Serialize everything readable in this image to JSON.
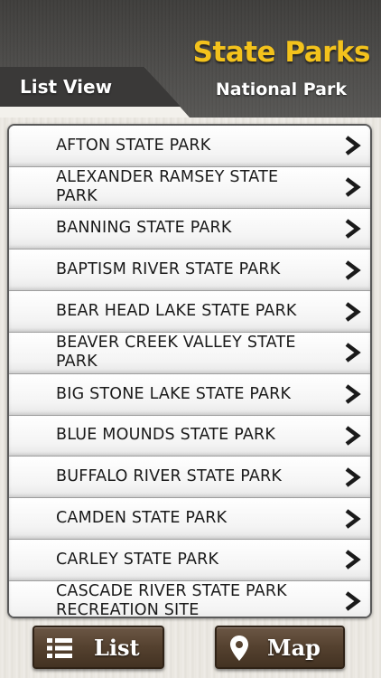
{
  "header": {
    "title": "State Parks",
    "subtitle": "National Park",
    "tab_label": "List View"
  },
  "colors": {
    "title": "#f3c21c",
    "header_bg": "#454442",
    "button_bg": "#5a4634"
  },
  "parks": [
    {
      "name": "AFTON STATE PARK",
      "icon": "chevron-right-icon"
    },
    {
      "name": "ALEXANDER RAMSEY STATE PARK",
      "icon": "chevron-right-icon"
    },
    {
      "name": "BANNING STATE PARK",
      "icon": "chevron-right-icon"
    },
    {
      "name": "BAPTISM RIVER STATE PARK",
      "icon": "chevron-right-icon"
    },
    {
      "name": "BEAR HEAD LAKE STATE PARK",
      "icon": "chevron-right-icon"
    },
    {
      "name": "BEAVER CREEK VALLEY STATE PARK",
      "icon": "chevron-right-icon"
    },
    {
      "name": "BIG STONE LAKE STATE PARK",
      "icon": "chevron-right-icon"
    },
    {
      "name": "BLUE MOUNDS STATE PARK",
      "icon": "chevron-right-icon"
    },
    {
      "name": "BUFFALO RIVER STATE PARK",
      "icon": "chevron-right-icon"
    },
    {
      "name": "CAMDEN STATE PARK",
      "icon": "chevron-right-icon"
    },
    {
      "name": "CARLEY STATE PARK",
      "icon": "chevron-right-icon"
    },
    {
      "name": "CASCADE RIVER STATE PARK RECREATION SITE",
      "icon": "chevron-right-icon"
    }
  ],
  "footer": {
    "list_label": "List",
    "list_icon": "list-icon",
    "map_label": "Map",
    "map_icon": "map-pin-icon"
  }
}
